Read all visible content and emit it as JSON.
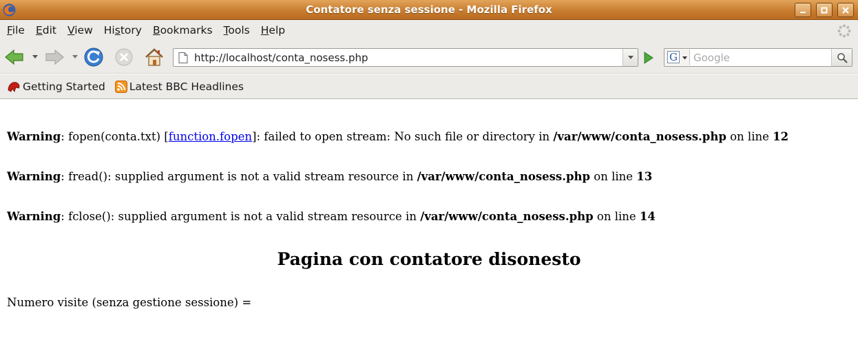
{
  "window": {
    "title": "Contatore senza sessione - Mozilla Firefox"
  },
  "menubar": {
    "items": [
      {
        "pre": "",
        "key": "F",
        "post": "ile"
      },
      {
        "pre": "",
        "key": "E",
        "post": "dit"
      },
      {
        "pre": "",
        "key": "V",
        "post": "iew"
      },
      {
        "pre": "Hi",
        "key": "s",
        "post": "tory"
      },
      {
        "pre": "",
        "key": "B",
        "post": "ookmarks"
      },
      {
        "pre": "",
        "key": "T",
        "post": "ools"
      },
      {
        "pre": "",
        "key": "H",
        "post": "elp"
      }
    ]
  },
  "navbar": {
    "url": "http://localhost/conta_nosess.php",
    "search_placeholder": "Google",
    "search_engine_letter": "G"
  },
  "bookmarks": {
    "items": [
      "Getting Started",
      "Latest BBC Headlines"
    ]
  },
  "page": {
    "warnings": [
      {
        "label": "Warning",
        "pre": ": fopen(conta.txt) [",
        "link": "function.fopen",
        "post": "]: failed to open stream: No such file or directory in ",
        "file": "/var/www/conta_nosess.php",
        "on_line": " on line ",
        "line": "12"
      },
      {
        "label": "Warning",
        "pre": ": fread(): supplied argument is not a valid stream resource in ",
        "file": "/var/www/conta_nosess.php",
        "on_line": " on line ",
        "line": "13"
      },
      {
        "label": "Warning",
        "pre": ": fclose(): supplied argument is not a valid stream resource in ",
        "file": "/var/www/conta_nosess.php",
        "on_line": " on line ",
        "line": "14"
      }
    ],
    "heading": "Pagina con contatore disonesto",
    "visits_text": "Numero visite (senza gestione sessione) ="
  },
  "colors": {
    "titlebar": "#c97d2e",
    "chrome": "#ecebe8",
    "link": "#0000ee"
  }
}
